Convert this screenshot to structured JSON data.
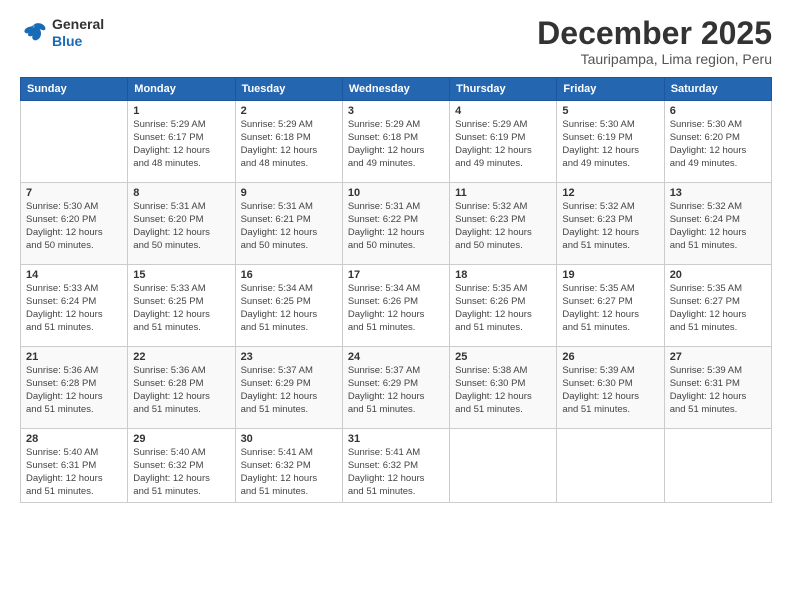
{
  "header": {
    "logo_line1": "General",
    "logo_line2": "Blue",
    "month_title": "December 2025",
    "subtitle": "Tauripampa, Lima region, Peru"
  },
  "weekdays": [
    "Sunday",
    "Monday",
    "Tuesday",
    "Wednesday",
    "Thursday",
    "Friday",
    "Saturday"
  ],
  "weeks": [
    [
      {
        "day": "",
        "info": ""
      },
      {
        "day": "1",
        "info": "Sunrise: 5:29 AM\nSunset: 6:17 PM\nDaylight: 12 hours\nand 48 minutes."
      },
      {
        "day": "2",
        "info": "Sunrise: 5:29 AM\nSunset: 6:18 PM\nDaylight: 12 hours\nand 48 minutes."
      },
      {
        "day": "3",
        "info": "Sunrise: 5:29 AM\nSunset: 6:18 PM\nDaylight: 12 hours\nand 49 minutes."
      },
      {
        "day": "4",
        "info": "Sunrise: 5:29 AM\nSunset: 6:19 PM\nDaylight: 12 hours\nand 49 minutes."
      },
      {
        "day": "5",
        "info": "Sunrise: 5:30 AM\nSunset: 6:19 PM\nDaylight: 12 hours\nand 49 minutes."
      },
      {
        "day": "6",
        "info": "Sunrise: 5:30 AM\nSunset: 6:20 PM\nDaylight: 12 hours\nand 49 minutes."
      }
    ],
    [
      {
        "day": "7",
        "info": "Sunrise: 5:30 AM\nSunset: 6:20 PM\nDaylight: 12 hours\nand 50 minutes."
      },
      {
        "day": "8",
        "info": "Sunrise: 5:31 AM\nSunset: 6:20 PM\nDaylight: 12 hours\nand 50 minutes."
      },
      {
        "day": "9",
        "info": "Sunrise: 5:31 AM\nSunset: 6:21 PM\nDaylight: 12 hours\nand 50 minutes."
      },
      {
        "day": "10",
        "info": "Sunrise: 5:31 AM\nSunset: 6:22 PM\nDaylight: 12 hours\nand 50 minutes."
      },
      {
        "day": "11",
        "info": "Sunrise: 5:32 AM\nSunset: 6:23 PM\nDaylight: 12 hours\nand 50 minutes."
      },
      {
        "day": "12",
        "info": "Sunrise: 5:32 AM\nSunset: 6:23 PM\nDaylight: 12 hours\nand 51 minutes."
      },
      {
        "day": "13",
        "info": "Sunrise: 5:32 AM\nSunset: 6:24 PM\nDaylight: 12 hours\nand 51 minutes."
      }
    ],
    [
      {
        "day": "14",
        "info": "Sunrise: 5:33 AM\nSunset: 6:24 PM\nDaylight: 12 hours\nand 51 minutes."
      },
      {
        "day": "15",
        "info": "Sunrise: 5:33 AM\nSunset: 6:25 PM\nDaylight: 12 hours\nand 51 minutes."
      },
      {
        "day": "16",
        "info": "Sunrise: 5:34 AM\nSunset: 6:25 PM\nDaylight: 12 hours\nand 51 minutes."
      },
      {
        "day": "17",
        "info": "Sunrise: 5:34 AM\nSunset: 6:26 PM\nDaylight: 12 hours\nand 51 minutes."
      },
      {
        "day": "18",
        "info": "Sunrise: 5:35 AM\nSunset: 6:26 PM\nDaylight: 12 hours\nand 51 minutes."
      },
      {
        "day": "19",
        "info": "Sunrise: 5:35 AM\nSunset: 6:27 PM\nDaylight: 12 hours\nand 51 minutes."
      },
      {
        "day": "20",
        "info": "Sunrise: 5:35 AM\nSunset: 6:27 PM\nDaylight: 12 hours\nand 51 minutes."
      }
    ],
    [
      {
        "day": "21",
        "info": "Sunrise: 5:36 AM\nSunset: 6:28 PM\nDaylight: 12 hours\nand 51 minutes."
      },
      {
        "day": "22",
        "info": "Sunrise: 5:36 AM\nSunset: 6:28 PM\nDaylight: 12 hours\nand 51 minutes."
      },
      {
        "day": "23",
        "info": "Sunrise: 5:37 AM\nSunset: 6:29 PM\nDaylight: 12 hours\nand 51 minutes."
      },
      {
        "day": "24",
        "info": "Sunrise: 5:37 AM\nSunset: 6:29 PM\nDaylight: 12 hours\nand 51 minutes."
      },
      {
        "day": "25",
        "info": "Sunrise: 5:38 AM\nSunset: 6:30 PM\nDaylight: 12 hours\nand 51 minutes."
      },
      {
        "day": "26",
        "info": "Sunrise: 5:39 AM\nSunset: 6:30 PM\nDaylight: 12 hours\nand 51 minutes."
      },
      {
        "day": "27",
        "info": "Sunrise: 5:39 AM\nSunset: 6:31 PM\nDaylight: 12 hours\nand 51 minutes."
      }
    ],
    [
      {
        "day": "28",
        "info": "Sunrise: 5:40 AM\nSunset: 6:31 PM\nDaylight: 12 hours\nand 51 minutes."
      },
      {
        "day": "29",
        "info": "Sunrise: 5:40 AM\nSunset: 6:32 PM\nDaylight: 12 hours\nand 51 minutes."
      },
      {
        "day": "30",
        "info": "Sunrise: 5:41 AM\nSunset: 6:32 PM\nDaylight: 12 hours\nand 51 minutes."
      },
      {
        "day": "31",
        "info": "Sunrise: 5:41 AM\nSunset: 6:32 PM\nDaylight: 12 hours\nand 51 minutes."
      },
      {
        "day": "",
        "info": ""
      },
      {
        "day": "",
        "info": ""
      },
      {
        "day": "",
        "info": ""
      }
    ]
  ]
}
